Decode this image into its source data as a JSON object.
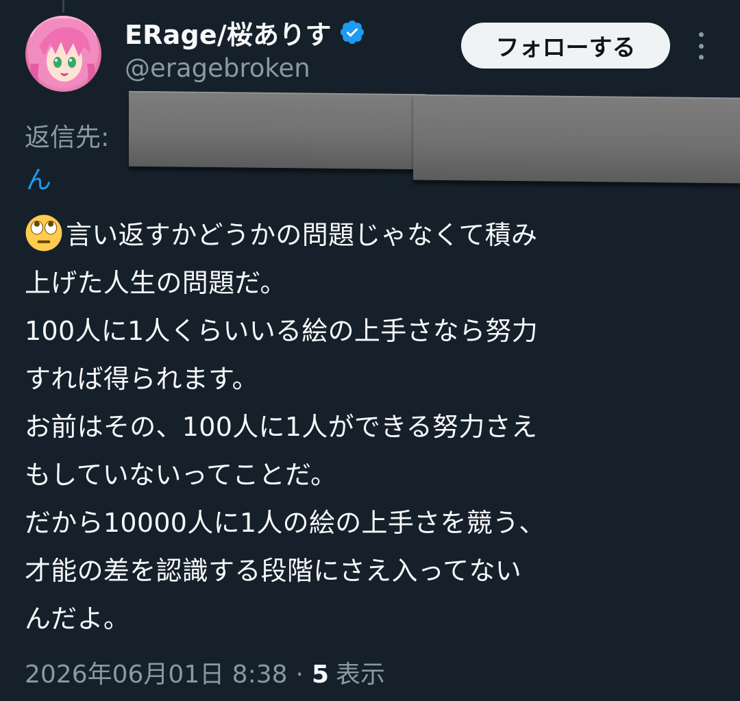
{
  "user": {
    "display_name": "ERage/桜ありす",
    "handle": "@eragebroken",
    "verified_icon": "verified-badge-icon",
    "avatar_icon": "anime-avatar-icon"
  },
  "actions": {
    "follow_label": "フォローする",
    "more_icon": "more-vertical-icon"
  },
  "reply": {
    "label": "返信先:",
    "handle_tail": "ん"
  },
  "tweet": {
    "emoji": "face-with-rolling-eyes-icon",
    "lines": [
      "言い返すかどうかの問題じゃなくて積み",
      "上げた人生の問題だ。",
      "100人に1人くらいいる絵の上手さなら努力",
      "すれば得られます。",
      "お前はその、100人に1人ができる努力さえ",
      "もしていないってことだ。",
      "だから10000人に1人の絵の上手さを競う、",
      "才能の差を認識する段階にさえ入ってない",
      "んだよ。"
    ]
  },
  "meta": {
    "timestamp": "2026年06月01日 8:38",
    "separator": "·",
    "view_count": "5",
    "view_label": "表示"
  },
  "colors": {
    "background": "#15202b",
    "primary_text": "#f7f9f9",
    "secondary_text": "#8b98a5",
    "link": "#1d9bf0",
    "verified": "#1d9bf0",
    "follow_button_bg": "#eff3f4",
    "follow_button_text": "#0f1419"
  }
}
